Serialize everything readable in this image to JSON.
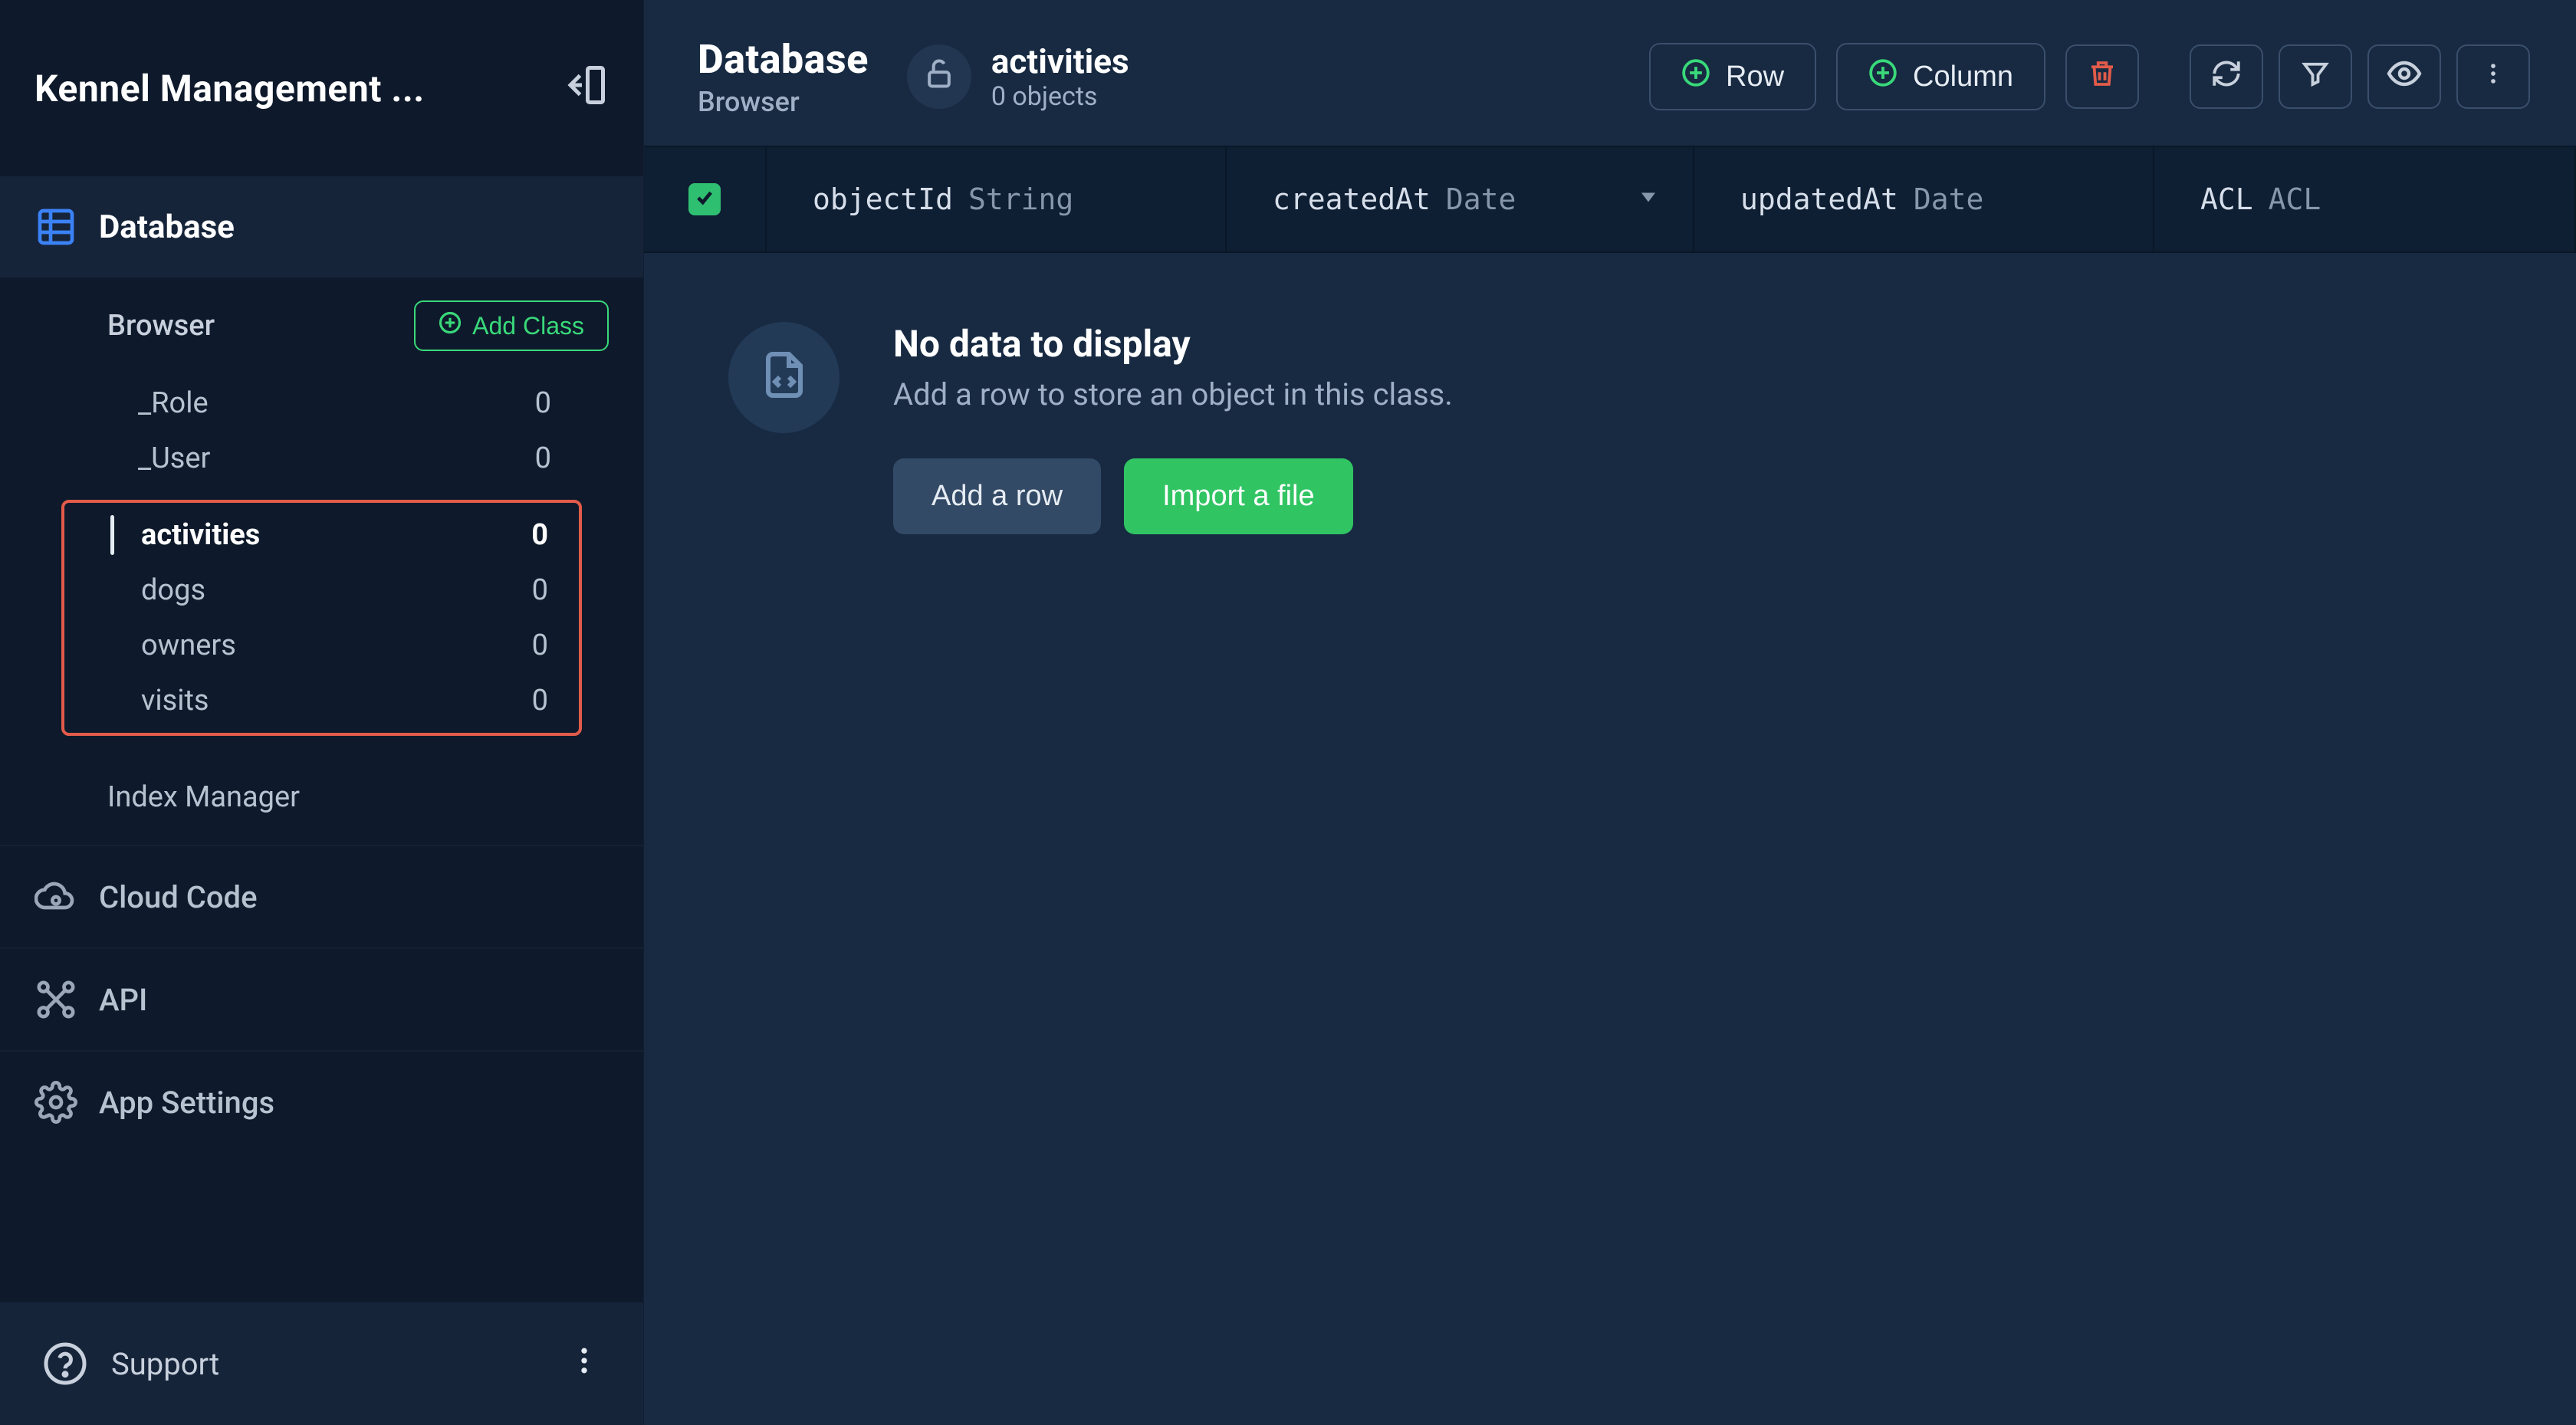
{
  "app": {
    "title": "Kennel Management ..."
  },
  "sidebar": {
    "sections": {
      "database": {
        "label": "Database"
      },
      "cloud_code": {
        "label": "Cloud Code"
      },
      "api": {
        "label": "API"
      },
      "app_settings": {
        "label": "App Settings"
      }
    },
    "browser": {
      "label": "Browser",
      "add_class_label": "Add Class"
    },
    "classes_prefixed": [
      {
        "name": "_Role",
        "count": "0"
      },
      {
        "name": "_User",
        "count": "0"
      }
    ],
    "classes_user": [
      {
        "name": "activities",
        "count": "0",
        "active": true
      },
      {
        "name": "dogs",
        "count": "0"
      },
      {
        "name": "owners",
        "count": "0"
      },
      {
        "name": "visits",
        "count": "0"
      }
    ],
    "index_manager_label": "Index Manager",
    "support_label": "Support"
  },
  "header": {
    "crumb_title": "Database",
    "crumb_sub": "Browser",
    "class_name": "activities",
    "class_sub": "0 objects",
    "row_btn": "Row",
    "column_btn": "Column"
  },
  "columns": {
    "objectId": {
      "name": "objectId",
      "type": "String"
    },
    "createdAt": {
      "name": "createdAt",
      "type": "Date"
    },
    "updatedAt": {
      "name": "updatedAt",
      "type": "Date"
    },
    "acl": {
      "name": "ACL",
      "type": "ACL"
    }
  },
  "empty": {
    "title": "No data to display",
    "subtitle": "Add a row to store an object in this class.",
    "add_row_btn": "Add a row",
    "import_btn": "Import a file"
  }
}
